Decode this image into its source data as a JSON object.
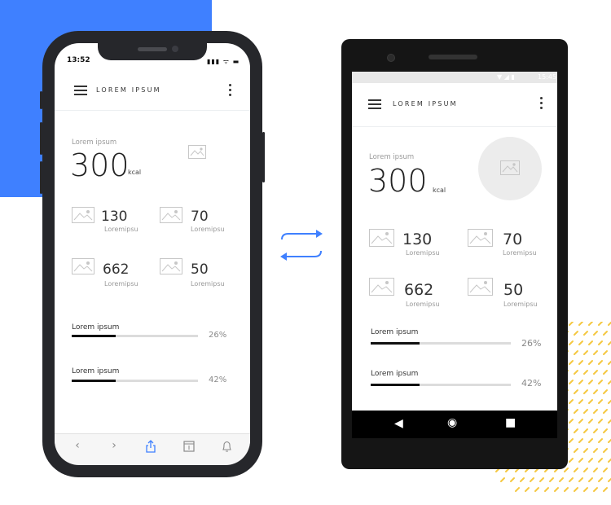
{
  "app": {
    "title": "LOREM IPSUM"
  },
  "ios": {
    "time": "13:52",
    "status_icons": "▮▮▮ ᯤ ▬",
    "toolbar_icons": [
      "chevron-left-icon",
      "chevron-right-icon",
      "share-icon",
      "bookmarks-icon",
      "bell-icon"
    ]
  },
  "android": {
    "time": "15:45",
    "status_icons": "▼ ◢ ▮"
  },
  "summary": {
    "label": "Lorem ipsum",
    "value": "300",
    "unit": "kcal"
  },
  "stats": [
    {
      "value": "130",
      "label": "Loremipsu"
    },
    {
      "value": "70",
      "label": "Loremipsu"
    },
    {
      "value": "662",
      "label": "Loremipsu"
    },
    {
      "value": "50",
      "label": "Loremipsu"
    }
  ],
  "progress": [
    {
      "label": "Lorem ipsum",
      "percent_text": "26%",
      "fill": 0.35
    },
    {
      "label": "Lorem ipsum",
      "percent_text": "42%",
      "fill": 0.35
    }
  ],
  "colors": {
    "accent": "#3f80ff",
    "dots": "#f5c842",
    "device": "#26272b"
  }
}
